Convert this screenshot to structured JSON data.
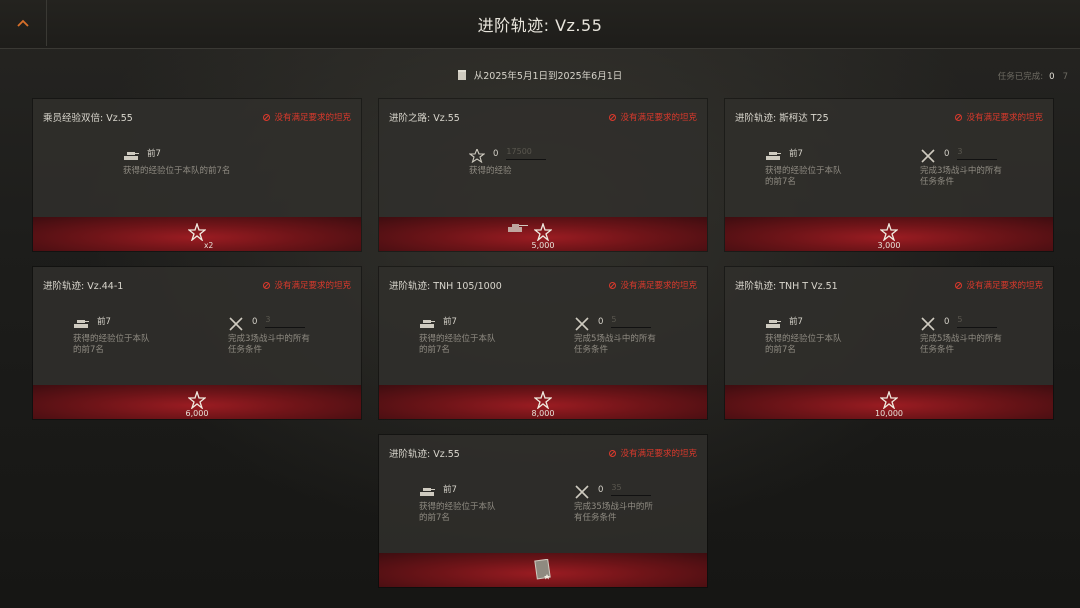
{
  "header": {
    "title": "进阶轨迹: Vz.55",
    "date_range": "从2025年5月1日到2025年6月1日",
    "completed_label": "任务已完成:",
    "completed_count": "0",
    "total_count": "7"
  },
  "requirement_text": "没有满足要求的坦克",
  "cards": [
    {
      "title": "乘员经验双倍: Vz.55",
      "cond1": {
        "head": "前7",
        "desc": "获得的经验位于本队的前7名"
      },
      "reward": {
        "amount": "",
        "multiplier": "x2"
      }
    },
    {
      "title": "进阶之路: Vz.55",
      "cond1": {
        "head_num": "0",
        "head_target": "17500",
        "desc": "获得的经验"
      },
      "reward": {
        "amount": "5,000"
      }
    },
    {
      "title": "进阶轨迹: 斯柯达 T25",
      "cond1": {
        "head": "前7",
        "desc1": "获得的经验位于本队",
        "desc2": "的前7名"
      },
      "cond2": {
        "num": "0",
        "target": "3",
        "desc1": "完成3场战斗中的所有",
        "desc2": "任务条件"
      },
      "reward": {
        "amount": "3,000"
      }
    },
    {
      "title": "进阶轨迹: Vz.44-1",
      "cond1": {
        "head": "前7",
        "desc1": "获得的经验位于本队",
        "desc2": "的前7名"
      },
      "cond2": {
        "num": "0",
        "target": "3",
        "desc1": "完成3场战斗中的所有",
        "desc2": "任务条件"
      },
      "reward": {
        "amount": "6,000"
      }
    },
    {
      "title": "进阶轨迹: TNH 105/1000",
      "cond1": {
        "head": "前7",
        "desc1": "获得的经验位于本队",
        "desc2": "的前7名"
      },
      "cond2": {
        "num": "0",
        "target": "5",
        "desc1": "完成5场战斗中的所有",
        "desc2": "任务条件"
      },
      "reward": {
        "amount": "8,000"
      }
    },
    {
      "title": "进阶轨迹: TNH T Vz.51",
      "cond1": {
        "head": "前7",
        "desc1": "获得的经验位于本队",
        "desc2": "的前7名"
      },
      "cond2": {
        "num": "0",
        "target": "5",
        "desc1": "完成5场战斗中的所有",
        "desc2": "任务条件"
      },
      "reward": {
        "amount": "10,000"
      }
    },
    {
      "title": "进阶轨迹: Vz.55",
      "cond1": {
        "head": "前7",
        "desc1": "获得的经验位于本队",
        "desc2": "的前7名"
      },
      "cond2": {
        "num": "0",
        "target": "35",
        "desc1": "完成35场战斗中的所",
        "desc2": "有任务条件"
      },
      "reward": {
        "amount": ""
      }
    }
  ],
  "colors": {
    "accent_red": "#d9392c",
    "reward_red": "#9b1c22",
    "back_arrow": "#d8702a"
  }
}
